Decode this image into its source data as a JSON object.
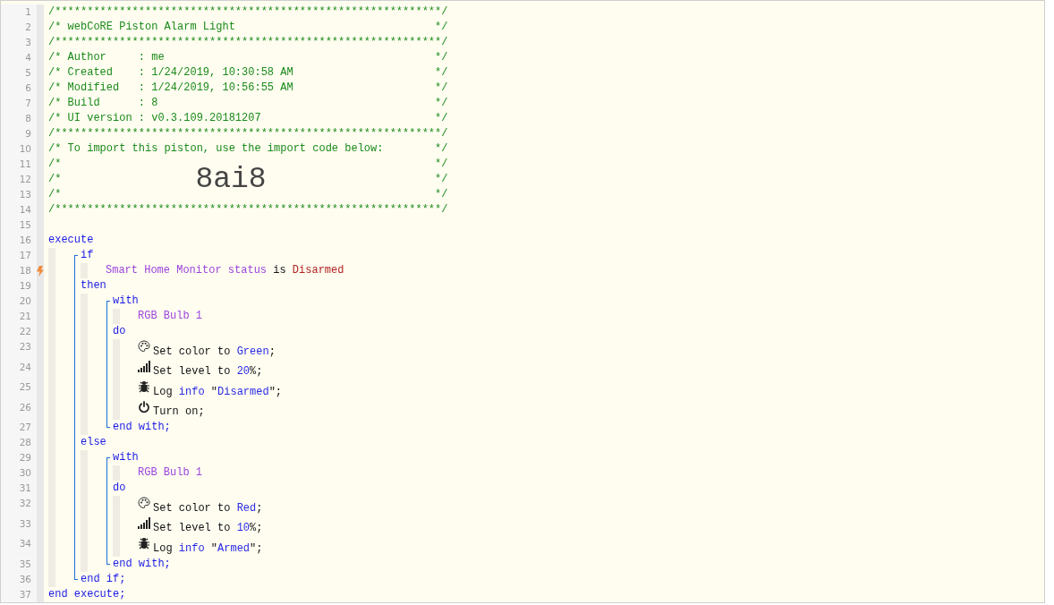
{
  "listing": [
    {
      "n": "1",
      "tokens": [
        {
          "kind": "comment",
          "text": "/************************************************************/"
        }
      ]
    },
    {
      "n": "2",
      "tokens": [
        {
          "kind": "comment",
          "text": "/* webCoRE Piston Alarm Light"
        }
      ],
      "end": "*/"
    },
    {
      "n": "3",
      "tokens": [
        {
          "kind": "comment",
          "text": "/************************************************************/"
        }
      ]
    },
    {
      "n": "4",
      "tokens": [
        {
          "kind": "comment",
          "text": "/* Author     : me"
        }
      ],
      "end": "*/"
    },
    {
      "n": "5",
      "tokens": [
        {
          "kind": "comment",
          "text": "/* Created    : 1/24/2019, 10:30:58 AM"
        }
      ],
      "end": "*/"
    },
    {
      "n": "6",
      "tokens": [
        {
          "kind": "comment",
          "text": "/* Modified   : 1/24/2019, 10:56:55 AM"
        }
      ],
      "end": "*/"
    },
    {
      "n": "7",
      "tokens": [
        {
          "kind": "comment",
          "text": "/* Build      : 8"
        }
      ],
      "end": "*/"
    },
    {
      "n": "8",
      "tokens": [
        {
          "kind": "comment",
          "text": "/* UI version : v0.3.109.20181207"
        }
      ],
      "end": "*/"
    },
    {
      "n": "9",
      "tokens": [
        {
          "kind": "comment",
          "text": "/************************************************************/"
        }
      ]
    },
    {
      "n": "10",
      "tokens": [
        {
          "kind": "comment",
          "text": "/* To import this piston, use the import code below:"
        }
      ],
      "end": "*/"
    },
    {
      "n": "11",
      "tokens": [
        {
          "kind": "comment",
          "text": "/*"
        }
      ],
      "end": "*/"
    },
    {
      "n": "12",
      "tokens": [
        {
          "kind": "comment",
          "text": "/*"
        },
        {
          "kind": "import-code",
          "text": "8ai8"
        }
      ],
      "end": "*/"
    },
    {
      "n": "13",
      "tokens": [
        {
          "kind": "comment",
          "text": "/*"
        }
      ],
      "end": "*/"
    },
    {
      "n": "14",
      "tokens": [
        {
          "kind": "comment",
          "text": "/************************************************************/"
        }
      ]
    },
    {
      "n": "15",
      "trigger": false
    },
    {
      "n": "16",
      "trigger": false,
      "tokens": [
        {
          "kind": "keyword",
          "text": "execute"
        }
      ],
      "children": [
        {
          "lines": [
            {
              "n": "17",
              "trigger": false,
              "tokens": [
                {
                  "kind": "keyword",
                  "text": "if"
                }
              ],
              "children": [
                {
                  "n": "18",
                  "trigger": true,
                  "tokens": [
                    {
                      "kind": "device",
                      "text": "Smart Home Monitor status"
                    },
                    {
                      "kind": "plain",
                      "text": " is "
                    },
                    {
                      "kind": "condition-value",
                      "text": "Disarmed"
                    }
                  ]
                }
              ]
            },
            {
              "n": "19",
              "trigger": false,
              "tokens": [
                {
                  "kind": "keyword",
                  "text": "then"
                }
              ],
              "children": [
                {
                  "lines": [
                    {
                      "n": "20",
                      "trigger": false,
                      "tokens": [
                        {
                          "kind": "keyword",
                          "text": "with"
                        }
                      ],
                      "children": [
                        {
                          "n": "21",
                          "trigger": false,
                          "tokens": [
                            {
                              "kind": "device",
                              "text": "RGB Bulb 1"
                            }
                          ]
                        }
                      ]
                    },
                    {
                      "n": "22",
                      "trigger": false,
                      "tokens": [
                        {
                          "kind": "keyword",
                          "text": "do"
                        }
                      ],
                      "children": [
                        {
                          "n": "23",
                          "trigger": false,
                          "kind": "set-color",
                          "tokens": [
                            {
                              "kind": "plain",
                              "text": "Set color to "
                            },
                            {
                              "kind": "value",
                              "text": "Green"
                            },
                            {
                              "kind": "plain",
                              "text": ";"
                            }
                          ]
                        },
                        {
                          "n": "24",
                          "trigger": false,
                          "kind": "set-level",
                          "tokens": [
                            {
                              "kind": "plain",
                              "text": "Set level to "
                            },
                            {
                              "kind": "value",
                              "text": "20"
                            },
                            {
                              "kind": "plain",
                              "text": "%;"
                            }
                          ]
                        },
                        {
                          "n": "25",
                          "trigger": false,
                          "kind": "log",
                          "tokens": [
                            {
                              "kind": "plain",
                              "text": "Log "
                            },
                            {
                              "kind": "value",
                              "text": "info"
                            },
                            {
                              "kind": "plain",
                              "text": " \""
                            },
                            {
                              "kind": "value",
                              "text": "Disarmed"
                            },
                            {
                              "kind": "plain",
                              "text": "\";"
                            }
                          ]
                        },
                        {
                          "n": "26",
                          "trigger": false,
                          "kind": "turn-on",
                          "tokens": [
                            {
                              "kind": "plain",
                              "text": "Turn on;"
                            }
                          ]
                        }
                      ]
                    },
                    {
                      "n": "27",
                      "trigger": false,
                      "tokens": [
                        {
                          "kind": "keyword",
                          "text": "end with;"
                        }
                      ]
                    }
                  ]
                }
              ]
            },
            {
              "n": "28",
              "trigger": false,
              "tokens": [
                {
                  "kind": "keyword",
                  "text": "else"
                }
              ],
              "children": [
                {
                  "lines": [
                    {
                      "n": "29",
                      "trigger": false,
                      "tokens": [
                        {
                          "kind": "keyword",
                          "text": "with"
                        }
                      ],
                      "children": [
                        {
                          "n": "30",
                          "trigger": false,
                          "tokens": [
                            {
                              "kind": "device",
                              "text": "RGB Bulb 1"
                            }
                          ]
                        }
                      ]
                    },
                    {
                      "n": "31",
                      "trigger": false,
                      "tokens": [
                        {
                          "kind": "keyword",
                          "text": "do"
                        }
                      ],
                      "children": [
                        {
                          "n": "32",
                          "trigger": false,
                          "kind": "set-color",
                          "tokens": [
                            {
                              "kind": "plain",
                              "text": "Set color to "
                            },
                            {
                              "kind": "value",
                              "text": "Red"
                            },
                            {
                              "kind": "plain",
                              "text": ";"
                            }
                          ]
                        },
                        {
                          "n": "33",
                          "trigger": false,
                          "kind": "set-level",
                          "tokens": [
                            {
                              "kind": "plain",
                              "text": "Set level to "
                            },
                            {
                              "kind": "value",
                              "text": "10"
                            },
                            {
                              "kind": "plain",
                              "text": "%;"
                            }
                          ]
                        },
                        {
                          "n": "34",
                          "trigger": false,
                          "kind": "log",
                          "tokens": [
                            {
                              "kind": "plain",
                              "text": "Log "
                            },
                            {
                              "kind": "value",
                              "text": "info"
                            },
                            {
                              "kind": "plain",
                              "text": " \""
                            },
                            {
                              "kind": "value",
                              "text": "Armed"
                            },
                            {
                              "kind": "plain",
                              "text": "\";"
                            }
                          ]
                        }
                      ]
                    },
                    {
                      "n": "35",
                      "trigger": false,
                      "tokens": [
                        {
                          "kind": "keyword",
                          "text": "end with;"
                        }
                      ]
                    }
                  ]
                }
              ]
            },
            {
              "n": "36",
              "trigger": false,
              "tokens": [
                {
                  "kind": "keyword",
                  "text": "end if;"
                }
              ]
            }
          ]
        }
      ]
    },
    {
      "n": "37",
      "trigger": false,
      "tokens": [
        {
          "kind": "keyword",
          "text": "end execute;"
        }
      ]
    }
  ]
}
